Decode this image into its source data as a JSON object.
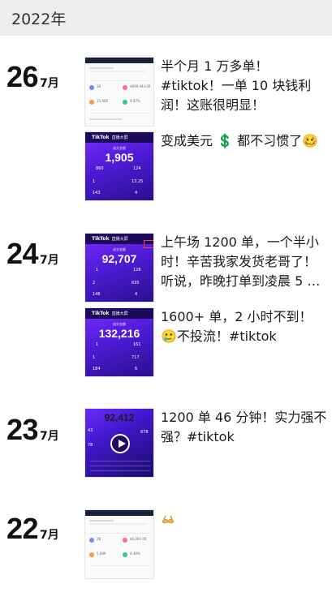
{
  "year_header": "2022年",
  "groups": [
    {
      "day": "26",
      "month": "7月",
      "posts": [
        {
          "caption": "半个月 1 万多单！ #tiktok！一单 10 块钱利润！这账很明显！",
          "thumb": {
            "type": "dashboard",
            "values": [
              "38",
              "$609,444.00",
              "15,906",
              "4.47%"
            ]
          }
        },
        {
          "caption": "变成美元 💲 都不习惯了🥴",
          "thumb": {
            "type": "tiktok",
            "big": "1,905",
            "stats": [
              "860",
              "124",
              "1",
              "13.25",
              "143",
              "4"
            ]
          }
        }
      ]
    },
    {
      "day": "24",
      "month": "7月",
      "posts": [
        {
          "caption": "上午场 1200 单，一个半小时！辛苦我家发货老哥了！听说，昨晚打单到凌晨 5 …",
          "thumb": {
            "type": "tiktok",
            "big": "92,707",
            "stats": [
              "1",
              "128",
              "2",
              "635",
              "146",
              "4"
            ]
          }
        },
        {
          "caption": "1600+ 单，2 小时不到！🥲不投流！#tiktok",
          "thumb": {
            "type": "tiktok",
            "big": "132,216",
            "stats": [
              "1",
              "161",
              "1",
              "717",
              "184",
              "6"
            ]
          }
        }
      ]
    },
    {
      "day": "23",
      "month": "7月",
      "posts": [
        {
          "caption": "1200 单 46 分钟！实力强不强？#tiktok",
          "thumb": {
            "type": "video",
            "big": "92,412",
            "stats": [
              "43",
              "678",
              "78"
            ]
          }
        }
      ]
    },
    {
      "day": "22",
      "month": "7月",
      "posts": [
        {
          "caption": "",
          "emoji": "🤷",
          "thumb": {
            "type": "dashboard",
            "values": [
              "28",
              "$6,001.00",
              "5,689",
              "4.48%"
            ]
          }
        }
      ]
    }
  ],
  "thumb_labels": {
    "tiktok_brand": "TikTok",
    "tiktok_tag": "直播大屏",
    "gmv_label": "成交金额"
  },
  "colors": {
    "accent_purple": "#5a1fe0",
    "year_bar_bg": "#ededed"
  }
}
